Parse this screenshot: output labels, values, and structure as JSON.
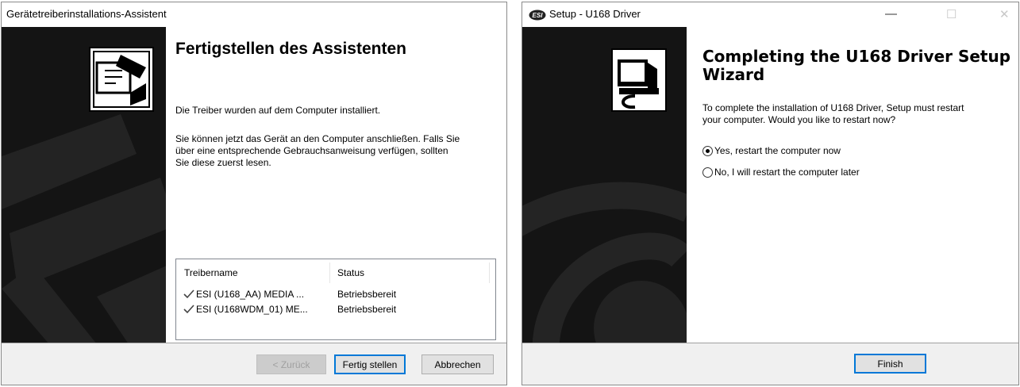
{
  "win1": {
    "title": "Gerätetreiberinstallations-Assistent",
    "heading": "Fertigstellen des Assistenten",
    "para1": "Die Treiber wurden auf dem Computer installiert.",
    "para2_line1": "Sie können jetzt das Gerät an den Computer anschließen. Falls Sie",
    "para2_line2": "über eine entsprechende Gebrauchsanweisung verfügen, sollten",
    "para2_line3": "Sie diese zuerst lesen.",
    "list": {
      "col_name": "Treibername",
      "col_status": "Status",
      "rows": [
        {
          "name": "ESI (U168_AA) MEDIA ...",
          "status": "Betriebsbereit"
        },
        {
          "name": "ESI (U168WDM_01) ME...",
          "status": "Betriebsbereit"
        }
      ]
    },
    "buttons": {
      "back": "< Zurück",
      "finish": "Fertig stellen",
      "cancel": "Abbrechen"
    }
  },
  "win2": {
    "title": "Setup - U168 Driver",
    "app_icon": "esi-logo-icon",
    "heading_line1": "Completing the U168 Driver Setup",
    "heading_line2": "Wizard",
    "para_line1": "To complete the installation of U168 Driver, Setup must restart",
    "para_line2": "your computer. Would you like to restart now?",
    "options": [
      {
        "label": "Yes, restart the computer now",
        "selected": true
      },
      {
        "label": "No, I will restart the computer later",
        "selected": false
      }
    ],
    "finish_label": "Finish",
    "caption": {
      "minimize": "—",
      "maximize": "☐",
      "close": "✕"
    }
  },
  "colors": {
    "panel": "#141414",
    "footer": "#f0f0f0",
    "accent": "#0078d7"
  }
}
